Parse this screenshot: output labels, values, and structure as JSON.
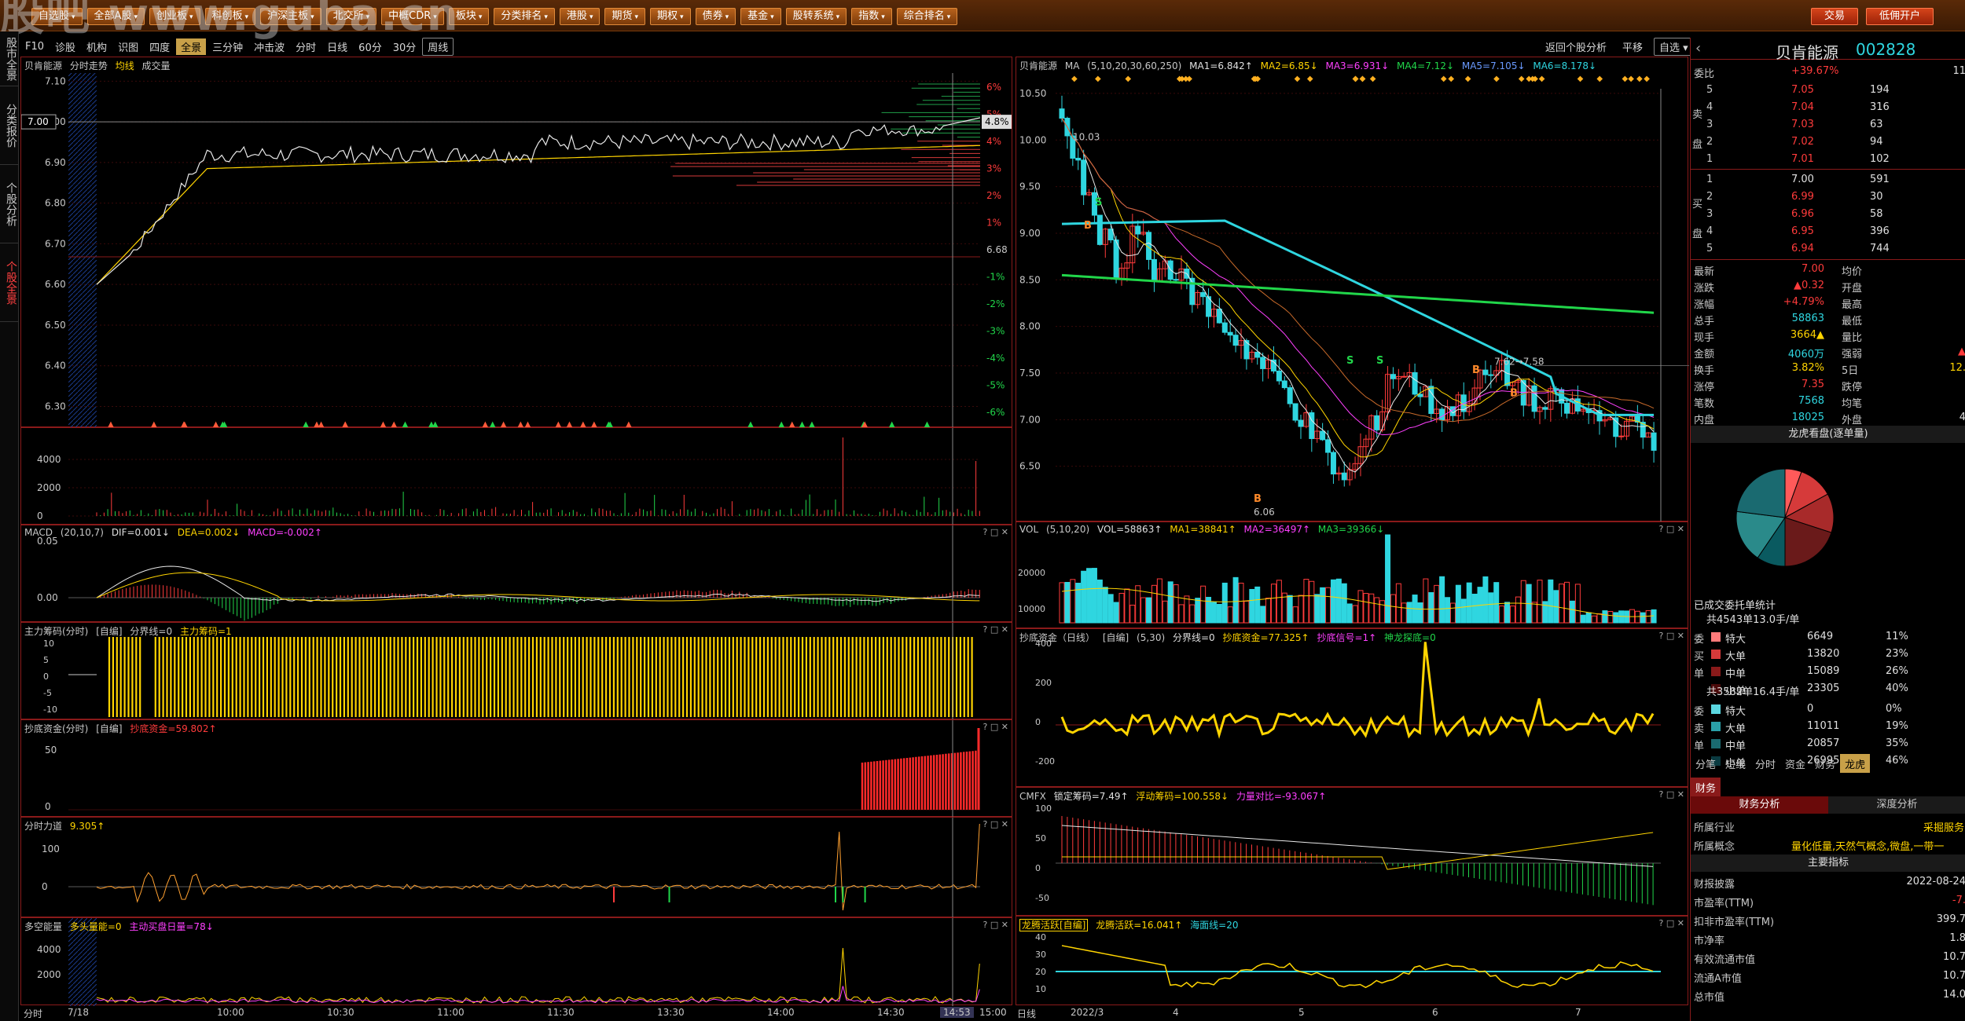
{
  "watermark": "股吧 www.guba.cn",
  "topbar": {
    "buttons": [
      "自选股",
      "全部A股",
      "创业板",
      "科创板",
      "沪深主板",
      "北交所",
      "中概CDR",
      "板块",
      "分类排名",
      "港股",
      "期货",
      "期权",
      "债券",
      "基金",
      "股转系统",
      "指数",
      "综合排名"
    ],
    "trade": "交易",
    "margin": "低佣开户"
  },
  "lefttabs": [
    "股市全景",
    "分类报价",
    "个股分析",
    "个股全景"
  ],
  "subbar": {
    "left": [
      "F10",
      "诊股",
      "机构",
      "识图",
      "四度",
      "全景",
      "三分钟",
      "冲击波",
      "分时",
      "日线",
      "60分",
      "30分",
      "周线"
    ],
    "active": "全景",
    "right_links": [
      "返回个股分析",
      "平移",
      "自选"
    ]
  },
  "intraday": {
    "stock_name": "贝肯能源",
    "label_trend": "分时走势",
    "label_avg": "均线",
    "label_vol": "成交量",
    "price_ticks": [
      "7.10",
      "7.00",
      "6.90",
      "6.80",
      "6.70",
      "6.60",
      "6.50",
      "6.40",
      "6.30"
    ],
    "pct_ticks": [
      "6%",
      "5%",
      "4%",
      "3%",
      "2%",
      "1%",
      "6.68",
      "-1%",
      "-2%",
      "-3%",
      "-4%",
      "-5%",
      "-6%"
    ],
    "current_pct": "4.8%",
    "current_price_marker": "7.00",
    "vol_ticks": [
      "4000",
      "2000",
      "0"
    ],
    "macd": {
      "name": "MACD",
      "params": "(20,10,7)",
      "dif": "DIF=0.001↓",
      "dea": "DEA=0.002↓",
      "macd": "MACD=-0.002↑",
      "ticks": [
        "0.05",
        "0.00"
      ]
    },
    "main_chip": {
      "name": "主力筹码(分时)",
      "sel": "[自编]",
      "sep": "分界线=0",
      "val": "主力筹码=1",
      "ticks": [
        "10",
        "5",
        "0",
        "-5",
        "-10"
      ]
    },
    "bottom_fund": {
      "name": "抄底资金(分时)",
      "sel": "[自编]",
      "val": "抄底资金=59.802↑",
      "ticks": [
        "50",
        "0"
      ]
    },
    "force": {
      "name": "分时力道",
      "val": "9.305↑",
      "ticks": [
        "100",
        "0"
      ]
    },
    "multi": {
      "name": "多空能量",
      "a": "多头量能=0",
      "b": "主动买盘日量=78↓",
      "ticks": [
        "4000",
        "2000"
      ]
    },
    "times": [
      "分时",
      "7/18",
      "10:00",
      "10:30",
      "11:00",
      "11:30",
      "13:30",
      "14:00",
      "14:30",
      "14:53",
      "15:00"
    ]
  },
  "daily": {
    "stock_name": "贝肯能源",
    "ma_label": "MA",
    "ma_params": "(5,10,20,30,60,250)",
    "ma_vals": [
      "MA1=6.842↑",
      "MA2=6.85↓",
      "MA3=6.931↓",
      "MA4=7.12↓",
      "MA5=7.105↓",
      "MA6=8.178↓"
    ],
    "price_ticks": [
      "10.50",
      "10.00",
      "9.50",
      "9.00",
      "8.50",
      "8.00",
      "7.50",
      "7.00",
      "6.50"
    ],
    "high_label": "10.03",
    "low_label": "6.06",
    "mid_label": "7.62→7.58",
    "vol": {
      "name": "VOL",
      "params": "(5,10,20)",
      "vol": "VOL=58863↑",
      "ma1": "MA1=38841↑",
      "ma2": "MA2=36497↑",
      "ma3": "MA3=39366↓",
      "ticks": [
        "20000",
        "10000"
      ]
    },
    "bottom_fund": {
      "name": "抄底资金（日线）",
      "sel": "[自编]",
      "params": "(5,30)",
      "a": "分界线=0",
      "b": "抄底资金=77.325↑",
      "c": "抄底信号=1↑",
      "d": "神龙探底=0",
      "ticks": [
        "400",
        "200",
        "0",
        "-200"
      ]
    },
    "cmfx": {
      "name": "CMFX",
      "a": "锁定筹码=7.49↑",
      "b": "浮动筹码=100.558↓",
      "c": "力量对比=-93.067↑",
      "ticks": [
        "100",
        "50",
        "0",
        "-50"
      ]
    },
    "dragon": {
      "name": "龙腾活跃[自编]",
      "a": "龙腾活跃=16.041↑",
      "b": "海面线=20",
      "ticks": [
        "40",
        "30",
        "20",
        "10"
      ]
    },
    "months": [
      "日线",
      "2022/3",
      "4",
      "5",
      "6",
      "7"
    ]
  },
  "quote": {
    "name": "贝肯能源",
    "code": "002828",
    "weibi_label": "委比",
    "weibi": "+39.67%",
    "weicha": "11",
    "sell": [
      {
        "lbl": "5",
        "p": "7.05",
        "v": "194"
      },
      {
        "lbl": "4",
        "p": "7.04",
        "v": "316"
      },
      {
        "lbl": "3",
        "p": "7.03",
        "v": "63"
      },
      {
        "lbl": "2",
        "p": "7.02",
        "v": "94"
      },
      {
        "lbl": "1",
        "p": "7.01",
        "v": "102"
      }
    ],
    "buy": [
      {
        "lbl": "1",
        "p": "7.00",
        "v": "591"
      },
      {
        "lbl": "2",
        "p": "6.99",
        "v": "30"
      },
      {
        "lbl": "3",
        "p": "6.96",
        "v": "58"
      },
      {
        "lbl": "4",
        "p": "6.95",
        "v": "396"
      },
      {
        "lbl": "5",
        "p": "6.94",
        "v": "744"
      }
    ],
    "sell_side": "卖盘",
    "buy_side": "买盘",
    "stats": [
      {
        "l1": "最新",
        "v1": "7.00",
        "c1": "red",
        "l2": "均价",
        "v2": "",
        "c2": "white"
      },
      {
        "l1": "涨跌",
        "v1": "▲0.32",
        "c1": "red",
        "l2": "开盘",
        "v2": "",
        "c2": "white"
      },
      {
        "l1": "涨幅",
        "v1": "+4.79%",
        "c1": "red",
        "l2": "最高",
        "v2": "",
        "c2": "white"
      },
      {
        "l1": "总手",
        "v1": "58863",
        "c1": "cyan",
        "l2": "最低",
        "v2": "",
        "c2": "white"
      },
      {
        "l1": "现手",
        "v1": "3664▲",
        "c1": "yellow",
        "l2": "量比",
        "v2": "",
        "c2": "white"
      },
      {
        "l1": "金额",
        "v1": "4060万",
        "c1": "cyan",
        "l2": "强弱",
        "v2": "▲",
        "c2": "red"
      },
      {
        "l1": "换手",
        "v1": "3.82%",
        "c1": "yellow",
        "l2": "5日",
        "v2": "12.",
        "c2": "yellow"
      },
      {
        "l1": "涨停",
        "v1": "7.35",
        "c1": "red",
        "l2": "跌停",
        "v2": "",
        "c2": "white"
      },
      {
        "l1": "笔数",
        "v1": "7568",
        "c1": "cyan",
        "l2": "均笔",
        "v2": "",
        "c2": "white"
      },
      {
        "l1": "内盘",
        "v1": "18025",
        "c1": "cyan",
        "l2": "外盘",
        "v2": "4",
        "c2": "white"
      }
    ],
    "dragon_title": "龙虎看盘(逐单量)",
    "pie_colors": [
      "#ff5a5a",
      "#d63a3a",
      "#a82a2a",
      "#6a1a1a",
      "#0a3a40",
      "#0a5a60",
      "#2a8a8a",
      "#1a6a70"
    ],
    "pie_values": [
      11,
      23,
      26,
      40,
      0,
      19,
      35,
      46
    ],
    "order_title": "已成交委托单统计",
    "buy_total": "共4543单13.0手/单",
    "buy_rows": [
      {
        "n": "特大",
        "v": "6649",
        "p": "11%",
        "c": "#ff7a7a"
      },
      {
        "n": "大单",
        "v": "13820",
        "p": "23%",
        "c": "#d63a3a"
      },
      {
        "n": "中单",
        "v": "15089",
        "p": "26%",
        "c": "#8a1a1a"
      },
      {
        "n": "小单",
        "v": "23305",
        "p": "40%",
        "c": "#4a0a0a"
      }
    ],
    "buy_side_label": [
      "委",
      "买",
      "单"
    ],
    "sell_total": "共3582单16.4手/单",
    "sell_rows": [
      {
        "n": "特大",
        "v": "0",
        "p": "0%",
        "c": "#5ad6e0"
      },
      {
        "n": "大单",
        "v": "11011",
        "p": "19%",
        "c": "#2aa0a8"
      },
      {
        "n": "中单",
        "v": "20857",
        "p": "35%",
        "c": "#1a6a70"
      },
      {
        "n": "小单",
        "v": "26995",
        "p": "46%",
        "c": "#0a3a40"
      }
    ],
    "sell_side_label": [
      "委",
      "卖",
      "单"
    ],
    "tabs": [
      "分笔",
      "短线",
      "分时",
      "资金",
      "财务",
      "龙虎"
    ],
    "tab_active": "龙虎",
    "fin_tab": "财务",
    "fin_tabs": [
      "财务分析",
      "深度分析"
    ],
    "industry_label": "所属行业",
    "industry": "采掘服务",
    "concept_label": "所属概念",
    "concept": "量化低量,天然气概念,微盘,一带一",
    "main_index": "主要指标",
    "fin_rows": [
      {
        "l": "财报披露",
        "v": "2022-08-24"
      },
      {
        "l": "市盈率(TTM)",
        "v": "-7."
      },
      {
        "l": "扣非市盈率(TTM)",
        "v": "399.7"
      },
      {
        "l": "市净率",
        "v": "1.8"
      },
      {
        "l": "有效流通市值",
        "v": "10.7"
      },
      {
        "l": "流通A市值",
        "v": "10.7"
      },
      {
        "l": "总市值",
        "v": "14.0"
      }
    ]
  }
}
